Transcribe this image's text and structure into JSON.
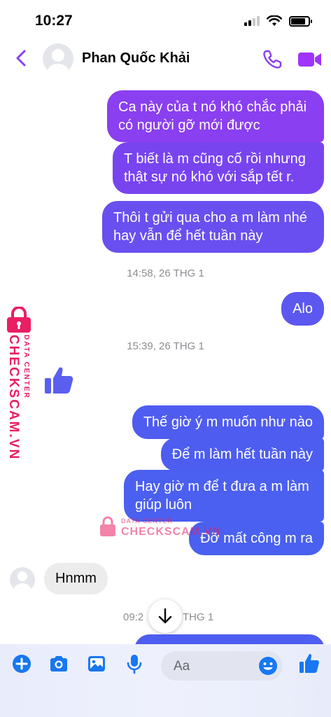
{
  "status_bar": {
    "time": "10:27",
    "battery_level": 0.85
  },
  "header": {
    "contact_name": "Phan Quốc Khải"
  },
  "messages": [
    {
      "type": "outgoing",
      "lines": [
        "Ca này của t nó khó chắc phải",
        "có người gỡ mới được"
      ]
    },
    {
      "type": "outgoing",
      "lines": [
        "T biết là m cũng cố rồi nhưng",
        "thật sự nó khó với sắp tết r."
      ]
    },
    {
      "type": "outgoing",
      "lines": [
        "Thôi t gửi qua cho a m làm nhé",
        "hay vẫn để hết tuần này"
      ]
    },
    {
      "type": "outgoing",
      "lines": [
        "Alo"
      ]
    },
    {
      "type": "outgoing",
      "lines": [
        "Thế giờ ý m muốn như nào"
      ]
    },
    {
      "type": "outgoing",
      "lines": [
        "Để m làm hết tuần này"
      ]
    },
    {
      "type": "outgoing",
      "lines": [
        "Hay giờ m để t đưa a m làm",
        "giúp luôn"
      ]
    },
    {
      "type": "outgoing",
      "lines": [
        "Đỡ mất công m ra"
      ]
    },
    {
      "type": "incoming",
      "lines": [
        "Hnmm"
      ]
    }
  ],
  "timestamps": [
    "14:58, 26 THG 1",
    "15:39, 26 THG 1",
    "09:2",
    "THG 1"
  ],
  "composer": {
    "placeholder": "Aa"
  },
  "watermark": {
    "brand": "CHECKSCAM.VN",
    "sub": "DATA CENTER"
  },
  "colors": {
    "purple": "#8a3ff0",
    "violet": "#6a4ff0",
    "blue": "#4d5df0",
    "accent": "#a033ff"
  }
}
